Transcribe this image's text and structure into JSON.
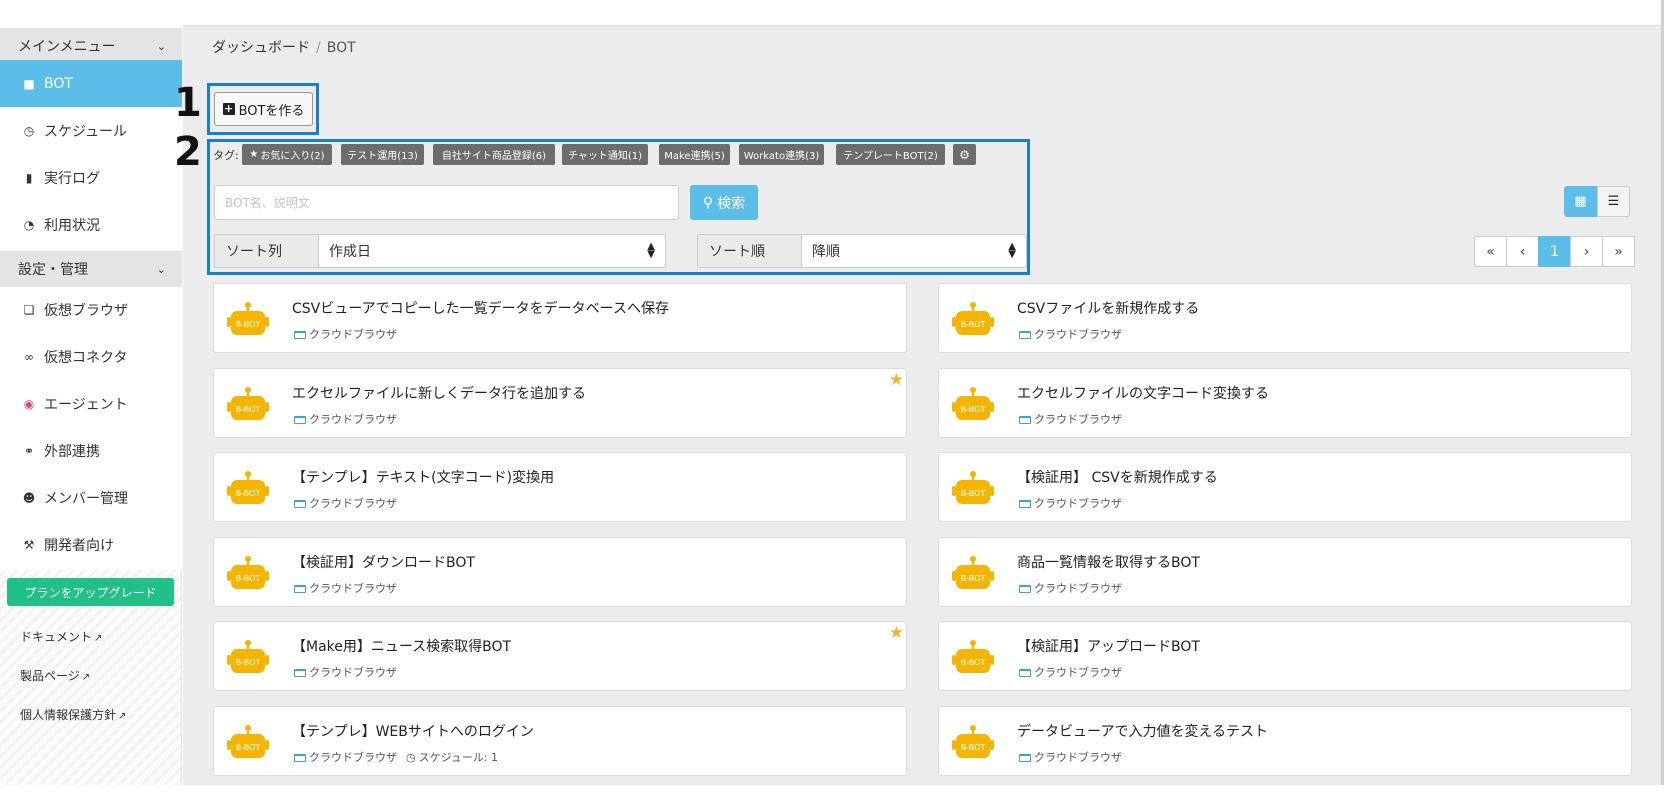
{
  "sidebar": {
    "main_menu_header": "メインメニュー",
    "items": [
      {
        "label": "BOT",
        "icon": "robot-icon",
        "active": true
      },
      {
        "label": "スケジュール",
        "icon": "clock-icon"
      },
      {
        "label": "実行ログ",
        "icon": "file-icon"
      },
      {
        "label": "利用状況",
        "icon": "pie-chart-icon"
      }
    ],
    "settings_header": "設定・管理",
    "settings_items": [
      {
        "label": "仮想ブラウザ",
        "icon": "window-icon"
      },
      {
        "label": "仮想コネクタ",
        "icon": "connector-icon"
      },
      {
        "label": "エージェント",
        "icon": "agent-icon"
      },
      {
        "label": "外部連携",
        "icon": "link-icon"
      },
      {
        "label": "メンバー管理",
        "icon": "users-icon"
      },
      {
        "label": "開発者向け",
        "icon": "wrench-icon"
      }
    ],
    "upgrade_label": "プランをアップグレード",
    "links": [
      "ドキュメント",
      "製品ページ",
      "個人情報保護方針"
    ]
  },
  "breadcrumb": {
    "home": "ダッシュボード",
    "separator": "/",
    "current": "BOT"
  },
  "markers": {
    "one": "1",
    "two": "2"
  },
  "create_button": "BOTを作る",
  "tags": {
    "label": "タグ:",
    "items": [
      "お気に入り(2)",
      "テスト運用(13)",
      "自社サイト商品登録(6)",
      "チャット通知(1)",
      "Make連携(5)",
      "Workato連携(3)",
      "テンプレートBOT(2)"
    ]
  },
  "search": {
    "placeholder": "BOT名、説明文",
    "value": "",
    "button": "検索"
  },
  "sort": {
    "column_label": "ソート列",
    "column_value": "作成日",
    "order_label": "ソート順",
    "order_value": "降順"
  },
  "pagination": {
    "first": "«",
    "prev": "‹",
    "current": "1",
    "next": "›",
    "last": "»"
  },
  "bot_badge": "B-BOT",
  "colors": {
    "accent": "#5dbde9",
    "upgrade": "#21c087",
    "highlight": "#1b7fc4",
    "star": "#f2b533",
    "bot": "#f5b400"
  },
  "bots": [
    {
      "title": "CSVビューアでコピーした一覧データをデータベースへ保存",
      "browser": "クラウドブラウザ",
      "favorite": false
    },
    {
      "title": "CSVファイルを新規作成する",
      "browser": "クラウドブラウザ",
      "favorite": false
    },
    {
      "title": "エクセルファイルに新しくデータ行を追加する",
      "browser": "クラウドブラウザ",
      "favorite": true
    },
    {
      "title": "エクセルファイルの文字コード変換する",
      "browser": "クラウドブラウザ",
      "favorite": false
    },
    {
      "title": "【テンプレ】テキスト(文字コード)変換用",
      "browser": "クラウドブラウザ",
      "favorite": false
    },
    {
      "title": "【検証用】 CSVを新規作成する",
      "browser": "クラウドブラウザ",
      "favorite": false
    },
    {
      "title": "【検証用】ダウンロードBOT",
      "browser": "クラウドブラウザ",
      "favorite": false
    },
    {
      "title": "商品一覧情報を取得するBOT",
      "browser": "クラウドブラウザ",
      "favorite": false
    },
    {
      "title": "【Make用】ニュース検索取得BOT",
      "browser": "クラウドブラウザ",
      "favorite": true
    },
    {
      "title": "【検証用】アップロードBOT",
      "browser": "クラウドブラウザ",
      "favorite": false
    },
    {
      "title": "【テンプレ】WEBサイトへのログイン",
      "browser": "クラウドブラウザ",
      "favorite": false,
      "schedule": "スケジュール: 1"
    },
    {
      "title": "データビューアで入力値を変えるテスト",
      "browser": "クラウドブラウザ",
      "favorite": false
    }
  ]
}
